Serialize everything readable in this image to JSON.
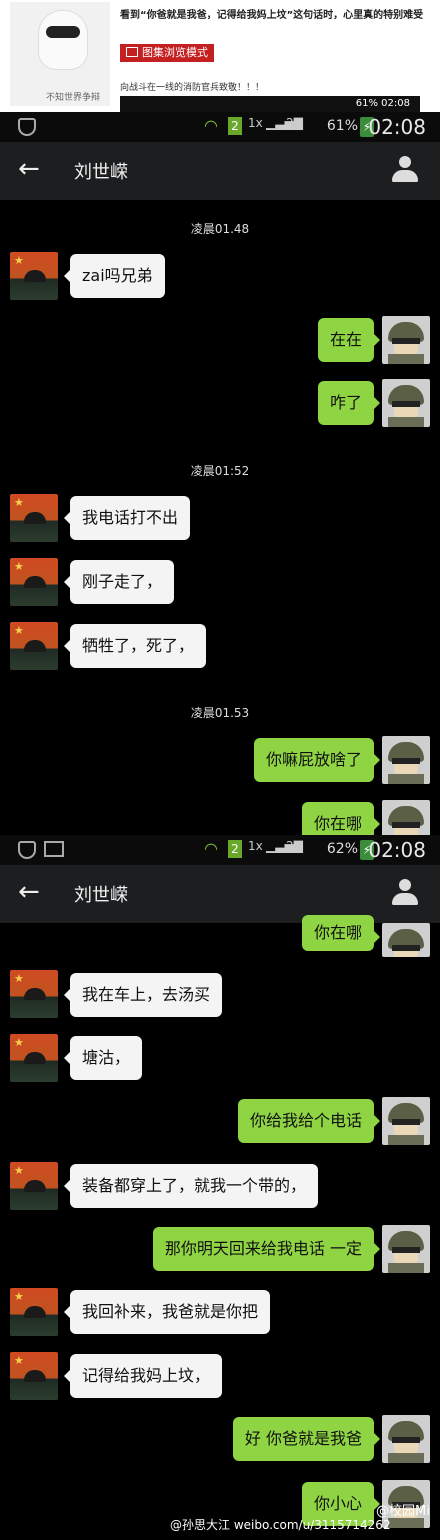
{
  "article": {
    "headline": "看到“你爸就是我爸，记得给我妈上坟”这句话时，心里真的特别难受",
    "avatar_name": "不知世界争辩",
    "gallery_button": "图集浏览模式",
    "caption": "向战斗在一线的消防官兵致敬！！！",
    "mini_status": "61% 02:08"
  },
  "screen1": {
    "status": {
      "time": "02:08",
      "battery": "61%",
      "sim": "2",
      "network_1": "1x",
      "network_2": "2G"
    },
    "header": {
      "contact": "刘世嵘"
    },
    "messages": [
      {
        "type": "time",
        "text": "凌晨01.48"
      },
      {
        "type": "in",
        "text": "zai吗兄弟"
      },
      {
        "type": "out",
        "text": "在在"
      },
      {
        "type": "out",
        "text": "咋了"
      },
      {
        "type": "time",
        "text": "凌晨01:52"
      },
      {
        "type": "in",
        "text": "我电话打不出"
      },
      {
        "type": "in",
        "text": "刚子走了，"
      },
      {
        "type": "in",
        "text": "牺牲了，死了，"
      },
      {
        "type": "time",
        "text": "凌晨01.53"
      },
      {
        "type": "out",
        "text": "你嘛屁放啥了"
      },
      {
        "type": "out",
        "text": "你在哪"
      }
    ]
  },
  "screen2": {
    "status": {
      "time": "02:08",
      "battery": "62%",
      "sim": "2",
      "network_1": "1x",
      "network_2": "2G"
    },
    "header": {
      "contact": "刘世嵘"
    },
    "messages": [
      {
        "type": "out",
        "text": "你在哪"
      },
      {
        "type": "in",
        "text": "我在车上，去汤买"
      },
      {
        "type": "in",
        "text": "塘沽，"
      },
      {
        "type": "out",
        "text": "你给我给个电话"
      },
      {
        "type": "in",
        "text": "装备都穿上了，就我一个带的，"
      },
      {
        "type": "out",
        "text": "那你明天回来给我电话 一定"
      },
      {
        "type": "in",
        "text": "我回补来，我爸就是你把"
      },
      {
        "type": "in",
        "text": "记得给我妈上坟，"
      },
      {
        "type": "out",
        "text": "好 你爸就是我爸"
      },
      {
        "type": "out",
        "text": "你小心"
      }
    ]
  },
  "watermark": {
    "text": "@孙思大江 weibo.com/u/3115714262",
    "tag": "@校园Mi"
  },
  "colors": {
    "bg": "#000000",
    "header": "#1c1e20",
    "outgoing": "#8fd443",
    "incoming": "#f4f4f4",
    "gallery": "#c52021"
  },
  "icons": [
    "back-arrow-icon",
    "profile-icon",
    "wifi-icon",
    "signal-icon",
    "battery-icon",
    "shield-icon"
  ]
}
